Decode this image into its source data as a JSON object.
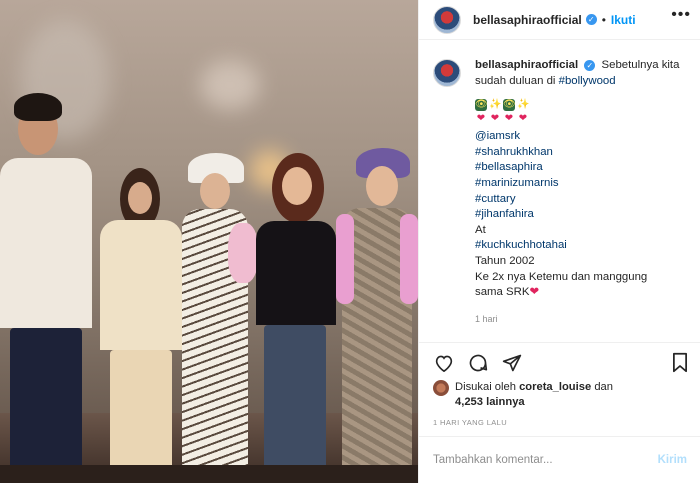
{
  "post": {
    "username": "bellasaphiraofficial",
    "follow_label": "Ikuti",
    "dot": "•",
    "more_icon": "more-icon"
  },
  "caption": {
    "username": "bellasaphiraofficial",
    "text_lines": [
      "Sebetulnya kita",
      "sudah duluan di"
    ],
    "first_tag": "#bollywood",
    "emoji_row1": [
      "👁",
      "✨",
      "👁",
      "✨"
    ],
    "emoji_row2": [
      "❤",
      "❤",
      "❤",
      "❤"
    ],
    "mention": "@iamsrk",
    "tags": [
      "#shahrukhkhan",
      "#bellasaphira",
      "#marinizumarnis",
      "#cuttary",
      "#jihanfahira"
    ],
    "at_label": "At",
    "place_tag": "#kuchkuchhotahai",
    "year_line": "Tahun 2002",
    "meet_line": "Ke 2x nya Ketemu dan manggung",
    "srk_line": "sama SRK",
    "srk_heart": "❤",
    "time": "1 hari"
  },
  "actions": {
    "like_icon": "heart-icon",
    "comment_icon": "comment-icon",
    "share_icon": "share-icon",
    "save_icon": "bookmark-icon"
  },
  "likes": {
    "prefix": "Disukai oleh",
    "liker": "coreta_louise",
    "conj": "dan",
    "count": "4,253 lainnya"
  },
  "posted": "1 HARI YANG LALU",
  "comment": {
    "placeholder": "Tambahkan komentar...",
    "send_label": "Kirim"
  },
  "colors": {
    "accent": "#0095f6",
    "link": "#00376b",
    "verified": "#3897f0",
    "muted": "#8e8e8e"
  }
}
